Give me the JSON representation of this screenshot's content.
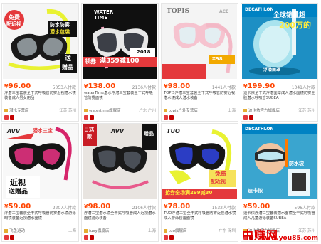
{
  "watermark": {
    "title": "中赚网",
    "url": "www.you85.com"
  },
  "products": [
    {
      "price": "96.00",
      "paid": "5053人付款",
      "title": "浮潜三宝套装全干式呼吸管防雾近视潜水镜装备成人男女用品",
      "shop": "潜水专营店",
      "location": "江苏 苏州",
      "overlay": [
        "免费",
        "配近视",
        "防水防雾",
        "潜水包袋",
        "送",
        "赠品"
      ]
    },
    {
      "price": "138.00",
      "paid": "2136人付款",
      "title": "waterTime潜水浮潜三宝套装全干式呼吸管防雾面镜",
      "shop": "watertime旗舰店",
      "location": "广东 广州",
      "overlay": [
        "WATER",
        "TIME",
        "领券",
        "满359减100",
        "2018"
      ]
    },
    {
      "price": "98.00",
      "paid": "1441人付款",
      "title": "TOPIS浮潜三宝套装全干式呼吸管防雾近视潜水镜成人潜水装备",
      "shop": "topis户外专营店",
      "location": "上海",
      "overlay": [
        "TOPIS",
        "¥98",
        "ACE"
      ]
    },
    {
      "price": "199.90",
      "paid": "1341人付款",
      "title": "迪卡侬全干式浮潜面罩成人潜水面镜防雾全脸潜水呼吸管SUBEA",
      "shop": "迪卡侬官方旗舰店",
      "location": "江苏 苏州",
      "overlay": [
        "DECATHLON",
        "全球销量超",
        "200万的",
        "浮潜面罩"
      ]
    },
    {
      "price": "59.00",
      "paid": "2207人付款",
      "title": "浮潜三宝套装全干式呼吸管防雾潜水镜游泳眼镜装备近视潜水面镜",
      "shop": "飞鱼运动",
      "location": "上海",
      "overlay": [
        "AVV",
        "潜水三宝",
        "近视",
        "送赠品"
      ]
    },
    {
      "price": "98.00",
      "paid": "2106人付款",
      "title": "浮潜三宝潜水镜全干式呼吸管成人近视潜水面镜游泳装备",
      "shop": "fuvy旗舰店",
      "location": "上海",
      "overlay": [
        "日式",
        "款",
        "AVV",
        "赠品"
      ]
    },
    {
      "price": "78.00",
      "paid": "1532人付款",
      "title": "TUO浮潜三宝全干式呼吸管防雾近视潜水镜成人游泳装备面镜",
      "shop": "tuo旗舰店",
      "location": "广东 深圳",
      "overlay": [
        "TUO",
        "免费",
        "配近视",
        "抢券全场满299减30"
      ]
    },
    {
      "price": "59.00",
      "paid": "596人付款",
      "title": "迪卡侬浮潜三宝套装潜水面镜全干式呼吸管成人儿童游泳装备SUBEA",
      "shop": "迪卡侬官方旗舰店",
      "location": "江苏 苏州",
      "overlay": [
        "DECATHLON",
        "防水袋",
        "迪卡侬"
      ]
    }
  ]
}
